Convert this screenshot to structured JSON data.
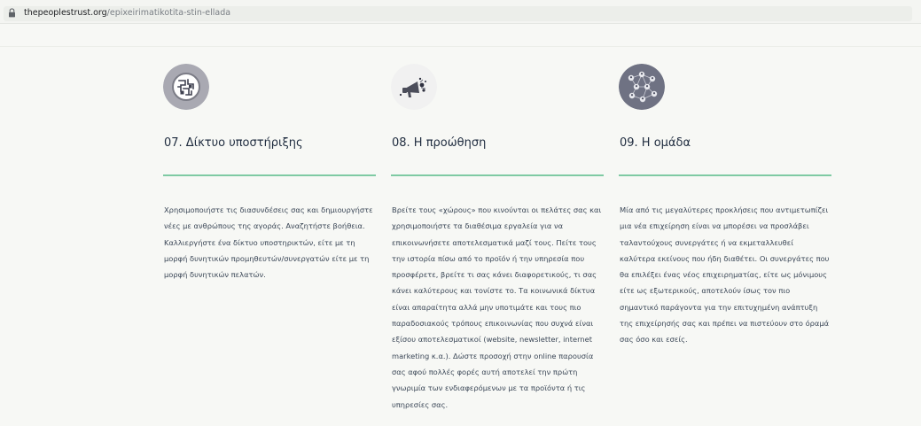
{
  "browser": {
    "url_domain": "thepeoplestrust.org",
    "url_path": "/epixeirimatikotita-stin-ellada",
    "lock_icon": "lock-icon"
  },
  "columns": [
    {
      "icon": "network-maze-icon",
      "title": "07. Δίκτυο υποστήριξης",
      "body": "Χρησιμοποιήστε τις διασυνδέσεις σας και δημιουργήστε νέες με ανθρώπους της αγοράς. Αναζητήστε βοήθεια. Καλλιεργήστε ένα δίκτυο υποστηρικτών, είτε με τη μορφή δυνητικών προμηθευτών/συνεργατών είτε με τη μορφή δυνητικών πελατών."
    },
    {
      "icon": "megaphone-icon",
      "title": "08. Η προώθηση",
      "body": "Βρείτε τους «χώρους» που κινούνται οι πελάτες σας και χρησιμοποιήστε τα διαθέσιμα εργαλεία για να επικοινωνήσετε αποτελεσματικά μαζί τους. Πείτε τους την ιστορία πίσω από το προϊόν ή την υπηρεσία που προσφέρετε, βρείτε τι σας κάνει διαφορετικούς, τι σας κάνει καλύτερους και τονίστε το. Τα κοινωνικά δίκτυα είναι απαραίτητα αλλά μην υποτιμάτε και τους πιο παραδοσιακούς τρόπους επικοινωνίας που συχνά είναι εξίσου αποτελεσματικοί (website, newsletter, internet marketing κ.α.). Δώστε προσοχή στην online παρουσία σας αφού πολλές φορές αυτή αποτελεί την πρώτη γνωριμία των ενδιαφερόμενων με τα προϊόντα ή τις υπηρεσίες σας."
    },
    {
      "icon": "team-network-icon",
      "title": "09. Η ομάδα",
      "body": "Μία από τις μεγαλύτερες προκλήσεις που αντιμετωπίζει μια νέα επιχείρηση είναι να μπορέσει να προσλάβει ταλαντούχους συνεργάτες ή να εκμεταλλευθεί καλύτερα εκείνους που ήδη διαθέτει. Οι συνεργάτες που θα επιλέξει ένας νέος επιχειρηματίας, είτε ως μόνιμους είτε ως εξωτερικούς, αποτελούν ίσως τον πιο σημαντικό παράγοντα για την επιτυχημένη ανάπτυξη της επιχείρησής σας και πρέπει να πιστεύουν στο όραμά σας όσο και εσείς."
    }
  ],
  "colors": {
    "accent_rule": "#7fcaa3",
    "title_text": "#1f2c3f",
    "body_text": "#3a4656",
    "avatar_1": "#a9a9b2",
    "avatar_2": "#f1f1f1",
    "avatar_3": "#6f7283"
  }
}
